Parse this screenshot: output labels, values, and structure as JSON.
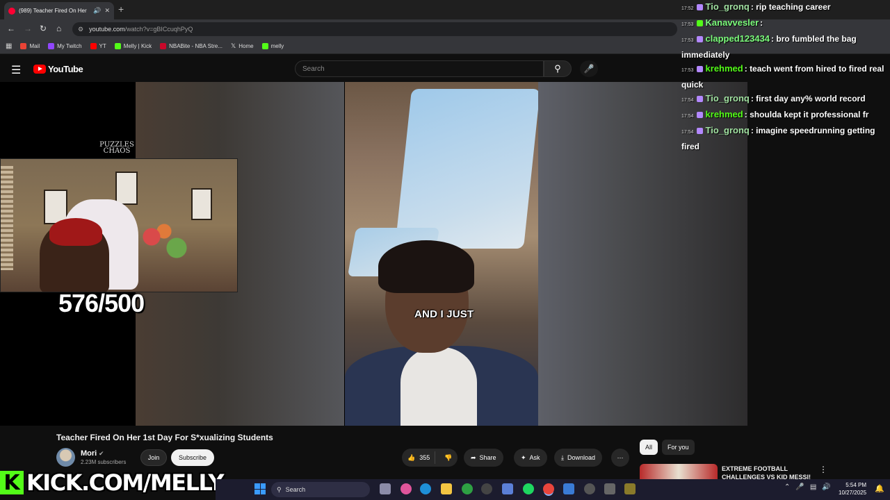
{
  "browser": {
    "tab_title": "(989) Teacher Fired On Her",
    "url_host": "youtube.com",
    "url_path": "/watch?v=gBICcuqhPyQ",
    "bookmarks": [
      {
        "label": "Mail",
        "color": "#ea4335"
      },
      {
        "label": "My Twitch",
        "color": "#9146ff"
      },
      {
        "label": "YT",
        "color": "#ff0000"
      },
      {
        "label": "Melly | Kick",
        "color": "#53fc18"
      },
      {
        "label": "NBABite - NBA Stre...",
        "color": "#c9082a"
      },
      {
        "label": "Home",
        "color": "#ffffff"
      },
      {
        "label": "melly",
        "color": "#53fc18"
      }
    ]
  },
  "youtube": {
    "logo_text": "YouTube",
    "search_placeholder": "Search",
    "caption": "AND I JUST",
    "video_title": "Teacher Fired On Her 1st Day For S*xualizing Students",
    "channel_name": "Mori",
    "subscribers": "2.23M subscribers",
    "join_label": "Join",
    "subscribe_label": "Subscribe",
    "likes": "355",
    "share_label": "Share",
    "ask_label": "Ask",
    "download_label": "Download",
    "chips": [
      "All",
      "For you"
    ],
    "recommended_title": "EXTREME FOOTBALL CHALLENGES VS KID MESSI!"
  },
  "stream_overlay": {
    "puzzles_logo": "PUZZLES CHAOS",
    "counter": "576/500",
    "kick_letter": "K",
    "kick_url": "KICK.COM/MELLY"
  },
  "chat": [
    {
      "time": "17:52",
      "user": "Tio_gronq",
      "user_color": "#a0e0a0",
      "text": ": rip teaching career",
      "badge": "purple"
    },
    {
      "time": "17:53",
      "user": "Kanavvesler",
      "user_color": "#7cfc7c",
      "text": ":",
      "badge": "green"
    },
    {
      "time": "17:53",
      "user": "clapped123434",
      "user_color": "#7cfc7c",
      "text": ": bro fumbled the bag immediately",
      "badge": "purple"
    },
    {
      "time": "17:53",
      "user": "krehmed",
      "user_color": "#53fc18",
      "text": ": teach went from hired to fired real quick",
      "badge": "purple"
    },
    {
      "time": "17:54",
      "user": "Tio_gronq",
      "user_color": "#a0e0a0",
      "text": ": first day any% world record",
      "badge": "purple"
    },
    {
      "time": "17:54",
      "user": "krehmed",
      "user_color": "#53fc18",
      "text": ": shoulda kept it professional fr",
      "badge": "purple"
    },
    {
      "time": "17:54",
      "user": "Tio_gronq",
      "user_color": "#a0e0a0",
      "text": ": imagine speedrunning getting fired",
      "badge": "purple"
    }
  ],
  "taskbar": {
    "search_label": "Search",
    "time": "5:54 PM",
    "date": "10/27/2025"
  },
  "colors": {
    "youtube_red": "#ff0000",
    "kick_green": "#53fc18",
    "background": "#0f0f0f"
  }
}
